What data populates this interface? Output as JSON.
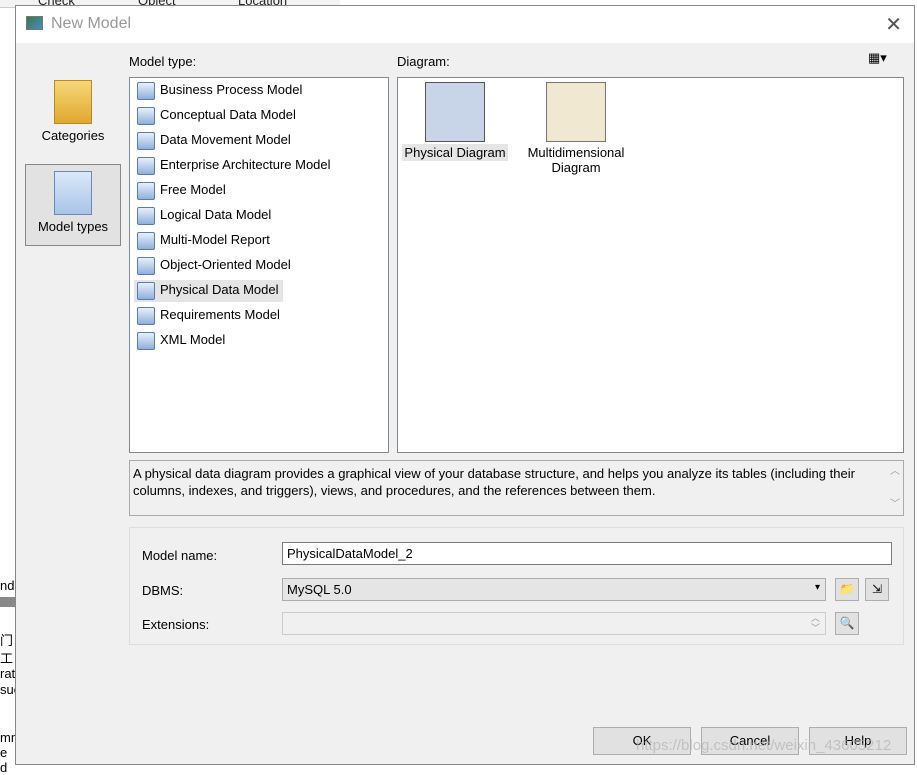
{
  "background": {
    "columns": [
      "Check",
      "Object",
      "Location"
    ],
    "fragments": [
      "nd",
      "门",
      "工",
      "rati",
      "suc",
      "mm",
      "e d"
    ]
  },
  "dialog": {
    "title": "New Model",
    "close": "✕"
  },
  "categories": [
    {
      "label": "Categories",
      "selected": false
    },
    {
      "label": "Model types",
      "selected": true
    }
  ],
  "model_type": {
    "label": "Model type:",
    "items": [
      {
        "label": "Business Process Model"
      },
      {
        "label": "Conceptual Data Model"
      },
      {
        "label": "Data Movement Model"
      },
      {
        "label": "Enterprise Architecture Model"
      },
      {
        "label": "Free Model"
      },
      {
        "label": "Logical Data Model"
      },
      {
        "label": "Multi-Model Report"
      },
      {
        "label": "Object-Oriented Model"
      },
      {
        "label": "Physical Data Model",
        "selected": true
      },
      {
        "label": "Requirements Model"
      },
      {
        "label": "XML Model"
      }
    ]
  },
  "diagram": {
    "label": "Diagram:",
    "view_icon": "view-grid-icon",
    "items": [
      {
        "label": "Physical Diagram",
        "selected": true
      },
      {
        "label": "Multidimensional Diagram"
      }
    ]
  },
  "description": "A physical data diagram provides a graphical view of your database structure, and helps you analyze its tables (including their columns, indexes, and triggers), views, and procedures, and the references between them.",
  "form": {
    "model_name_label": "Model name:",
    "model_name": "PhysicalDataModel_2",
    "dbms_label": "DBMS:",
    "dbms": "MySQL 5.0",
    "extensions_label": "Extensions:",
    "extensions": ""
  },
  "buttons": {
    "ok": "OK",
    "cancel": "Cancel",
    "help": "Help"
  },
  "watermark": "https://blog.csdn.net/weixin_43605212"
}
